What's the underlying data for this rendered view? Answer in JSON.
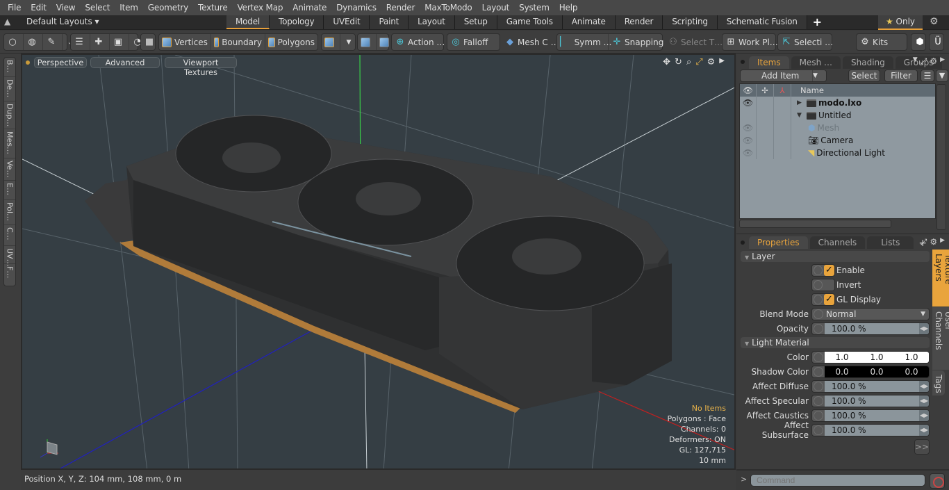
{
  "menu": [
    "File",
    "Edit",
    "View",
    "Select",
    "Item",
    "Geometry",
    "Texture",
    "Vertex Map",
    "Animate",
    "Dynamics",
    "Render",
    "MaxToModo",
    "Layout",
    "System",
    "Help"
  ],
  "layouts": {
    "label": "Default Layouts ▾"
  },
  "mode_tabs": [
    {
      "label": "Model",
      "active": true
    },
    {
      "label": "Topology"
    },
    {
      "label": "UVEdit"
    },
    {
      "label": "Paint"
    },
    {
      "label": "Layout"
    },
    {
      "label": "Setup"
    },
    {
      "label": "Game Tools"
    },
    {
      "label": "Animate"
    },
    {
      "label": "Render"
    },
    {
      "label": "Scripting"
    },
    {
      "label": "Schematic Fusion"
    }
  ],
  "only_button": {
    "label": "Only"
  },
  "toolbar": {
    "vertices": "Vertices",
    "boundary": "Boundary",
    "polygons": "Polygons",
    "action": "Action  …",
    "falloff": "Falloff",
    "mesh_c": "Mesh C …",
    "symm": "Symm …",
    "snapping": "Snapping",
    "select_t": "Select T…",
    "work_pl": "Work Pl…",
    "selecti": "Selecti …",
    "kits": "Kits"
  },
  "left_tools": [
    "B…",
    "De…",
    "Dup…",
    "Mes…",
    "Ve…",
    "E…",
    "Pol…",
    "C…",
    "UV…",
    "F…"
  ],
  "viewport": {
    "view": "Perspective",
    "advanced": "Advanced",
    "textures": "Viewport Textures",
    "info": {
      "items": "No Items",
      "polygons": "Polygons : Face",
      "channels": "Channels: 0",
      "deformers": "Deformers: ON",
      "gl": "GL: 127,715",
      "scale": "10 mm"
    }
  },
  "status": {
    "position": "Position X, Y, Z:   104 mm, 108 mm, 0 m"
  },
  "items_panel": {
    "tabs": [
      {
        "label": "Items",
        "active": true
      },
      {
        "label": "Mesh …"
      },
      {
        "label": "Shading"
      },
      {
        "label": "Groups"
      }
    ],
    "add_item": "Add Item",
    "select": "Select",
    "filter": "Filter",
    "name_header": "Name",
    "rows": [
      {
        "name": "modo.lxo",
        "bold": true
      },
      {
        "name": "Untitled"
      },
      {
        "name": "Mesh",
        "dim": true
      },
      {
        "name": "Camera"
      },
      {
        "name": "Directional Light"
      }
    ]
  },
  "props_panel": {
    "tabs": [
      {
        "label": "Properties",
        "active": true
      },
      {
        "label": "Channels"
      },
      {
        "label": "Lists"
      }
    ],
    "layer_section": "Layer",
    "enable": {
      "label": "Enable",
      "checked": true
    },
    "invert": {
      "label": "Invert",
      "checked": false
    },
    "gl_display": {
      "label": "GL Display",
      "checked": true
    },
    "blend_mode": {
      "label": "Blend Mode",
      "value": "Normal"
    },
    "opacity": {
      "label": "Opacity",
      "value": "100.0 %"
    },
    "light_section": "Light Material",
    "color": {
      "label": "Color",
      "r": "1.0",
      "g": "1.0",
      "b": "1.0"
    },
    "shadow_color": {
      "label": "Shadow Color",
      "r": "0.0",
      "g": "0.0",
      "b": "0.0"
    },
    "affect_diffuse": {
      "label": "Affect Diffuse",
      "value": "100.0 %"
    },
    "affect_specular": {
      "label": "Affect Specular",
      "value": "100.0 %"
    },
    "affect_caustics": {
      "label": "Affect Caustics",
      "value": "100.0 %"
    },
    "affect_subsurface": {
      "label": "Affect Subsurface",
      "value": "100.0 %"
    },
    "more": ">>",
    "side_tabs": [
      {
        "label": "Texture Layers",
        "active": true
      },
      {
        "label": "User Channels"
      },
      {
        "label": "Tags"
      }
    ]
  },
  "command": {
    "placeholder": "Command",
    "prompt": ">"
  }
}
